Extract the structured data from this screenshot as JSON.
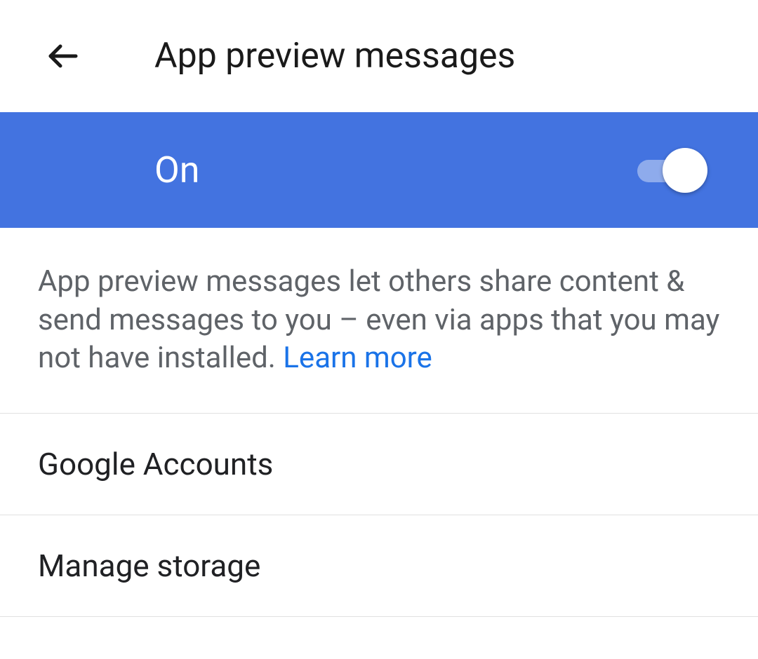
{
  "header": {
    "title": "App preview messages"
  },
  "toggle": {
    "label": "On"
  },
  "description": {
    "text": "App preview messages let others share content & send messages to you – even via apps that you may not have installed. ",
    "learn_more": "Learn more"
  },
  "list_items": [
    {
      "label": "Google Accounts"
    },
    {
      "label": "Manage storage"
    }
  ]
}
